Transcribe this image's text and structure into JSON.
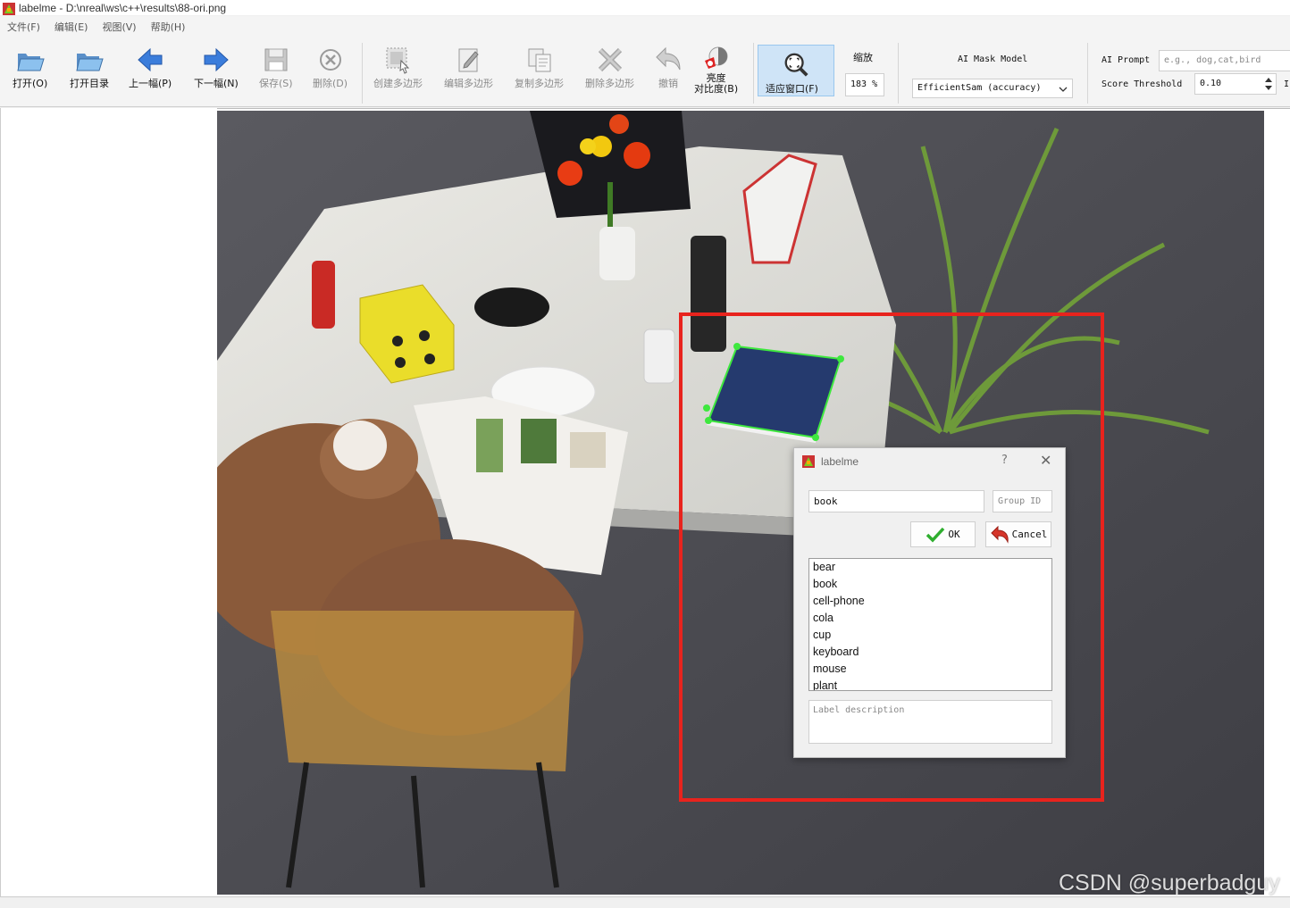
{
  "window": {
    "title": "labelme - D:\\nreal\\ws\\c++\\results\\88-ori.png"
  },
  "menu": [
    "文件(F)",
    "编辑(E)",
    "视图(V)",
    "帮助(H)"
  ],
  "toolbar": {
    "open": "打开(O)",
    "open_dir": "打开目录",
    "prev": "上一幅(P)",
    "next": "下一幅(N)",
    "save": "保存(S)",
    "delete": "删除(D)",
    "create_polygon": "创建多边形",
    "edit_polygon": "编辑多边形",
    "copy_polygon": "复制多边形",
    "delete_polygon": "删除多边形",
    "undo": "撤销",
    "brightness_line1": "亮度",
    "brightness_line2": "对比度(B)",
    "fit_window": "适应窗口(F)",
    "zoom_label": "缩放",
    "zoom_value": "183 %",
    "ai_mask_label": "AI Mask Model",
    "ai_mask_value": "EfficientSam (accuracy)",
    "ai_prompt_label": "AI Prompt",
    "ai_prompt_placeholder": "e.g., dog,cat,bird",
    "score_label": "Score Threshold",
    "score_value": "0.10",
    "trailing_char": "I"
  },
  "dialog": {
    "title": "labelme",
    "help": "?",
    "label_value": "book",
    "group_id_placeholder": "Group ID",
    "ok": "OK",
    "cancel": "Cancel",
    "labels": [
      "bear",
      "book",
      "cell-phone",
      "cola",
      "cup",
      "keyboard",
      "mouse",
      "plant"
    ],
    "description_placeholder": "Label description"
  },
  "watermark": "CSDN @superbadguy",
  "colors": {
    "highlight_box": "#e8231d",
    "polygon": "#3ee83e",
    "fit_button_bg": "#cfe4f7"
  }
}
